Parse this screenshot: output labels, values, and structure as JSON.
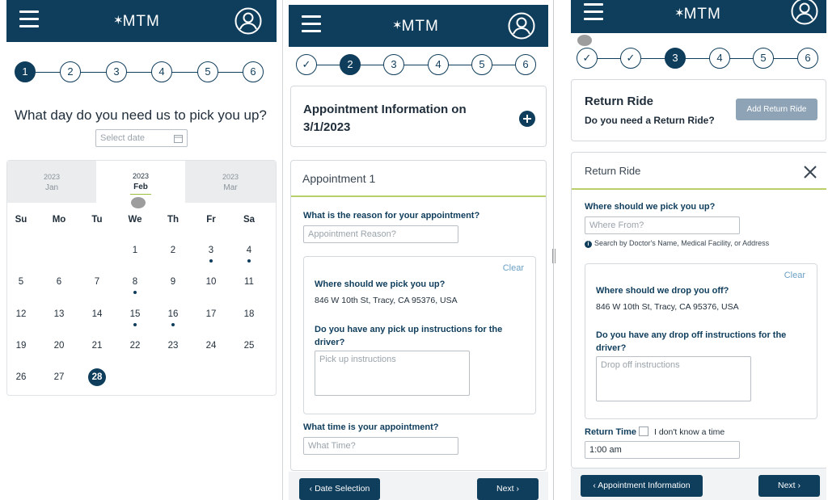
{
  "brand": {
    "name": "MTM",
    "header_color": "#0f3d5c",
    "accent": "#0f3d5c"
  },
  "panel1": {
    "steps": [
      "1",
      "2",
      "3",
      "4",
      "5",
      "6"
    ],
    "question": "What day do you need us to pick you up?",
    "date_placeholder": "Select date",
    "months": [
      {
        "year": "2023",
        "month": "Jan"
      },
      {
        "year": "2023",
        "month": "Feb"
      },
      {
        "year": "2023",
        "month": "Mar"
      }
    ],
    "weekdays": [
      "Su",
      "Mo",
      "Tu",
      "We",
      "Th",
      "Fr",
      "Sa"
    ],
    "days": [
      [
        "",
        "",
        "",
        "1",
        "2",
        "3",
        "4"
      ],
      [
        "5",
        "6",
        "7",
        "8",
        "9",
        "10",
        "11"
      ],
      [
        "12",
        "13",
        "14",
        "15",
        "16",
        "17",
        "18"
      ],
      [
        "19",
        "20",
        "21",
        "22",
        "23",
        "24",
        "25"
      ],
      [
        "26",
        "27",
        "28",
        "",
        "",
        "",
        ""
      ]
    ],
    "marked_days": [
      "3",
      "4",
      "8",
      "15",
      "16"
    ],
    "today": "28"
  },
  "panel2": {
    "steps": [
      "✓",
      "2",
      "3",
      "4",
      "5",
      "6"
    ],
    "appt_info_title": "Appointment Information on",
    "appt_info_date": "3/1/2023",
    "appointment_heading": "Appointment 1",
    "reason_label": "What is the reason for your appointment?",
    "reason_placeholder": "Appointment Reason?",
    "clear": "Clear",
    "pickup_label": "Where should we pick you up?",
    "pickup_address": "846 W 10th St, Tracy, CA 95376, USA",
    "instructions_label_1": "Do you have any pick up instructions for the",
    "instructions_label_2": "driver?",
    "instructions_placeholder": "Pick up instructions",
    "time_label": "What time is your appointment?",
    "time_placeholder": "What Time?",
    "back_button": "Date Selection",
    "next_button": "Next"
  },
  "panel3": {
    "steps": [
      "✓",
      "✓",
      "3",
      "4",
      "5",
      "6"
    ],
    "return_title": "Return Ride",
    "return_question": "Do you need a Return Ride?",
    "add_return_button": "Add Return Ride",
    "return_card_heading": "Return Ride",
    "pickup_label": "Where should we pick you up?",
    "pickup_placeholder": "Where From?",
    "hint": "Search by Doctor's Name, Medical Facility, or Address",
    "clear": "Clear",
    "dropoff_label": "Where should we drop you off?",
    "dropoff_address": "846 W 10th St, Tracy, CA 95376, USA",
    "instructions_label_1": "Do you have any drop off instructions for the",
    "instructions_label_2": "driver?",
    "instructions_placeholder": "Drop off instructions",
    "return_time_label": "Return Time",
    "dont_know_label": "I don't know a time",
    "return_time_value": "1:00 am",
    "back_button": "Appointment Information",
    "next_button": "Next"
  }
}
